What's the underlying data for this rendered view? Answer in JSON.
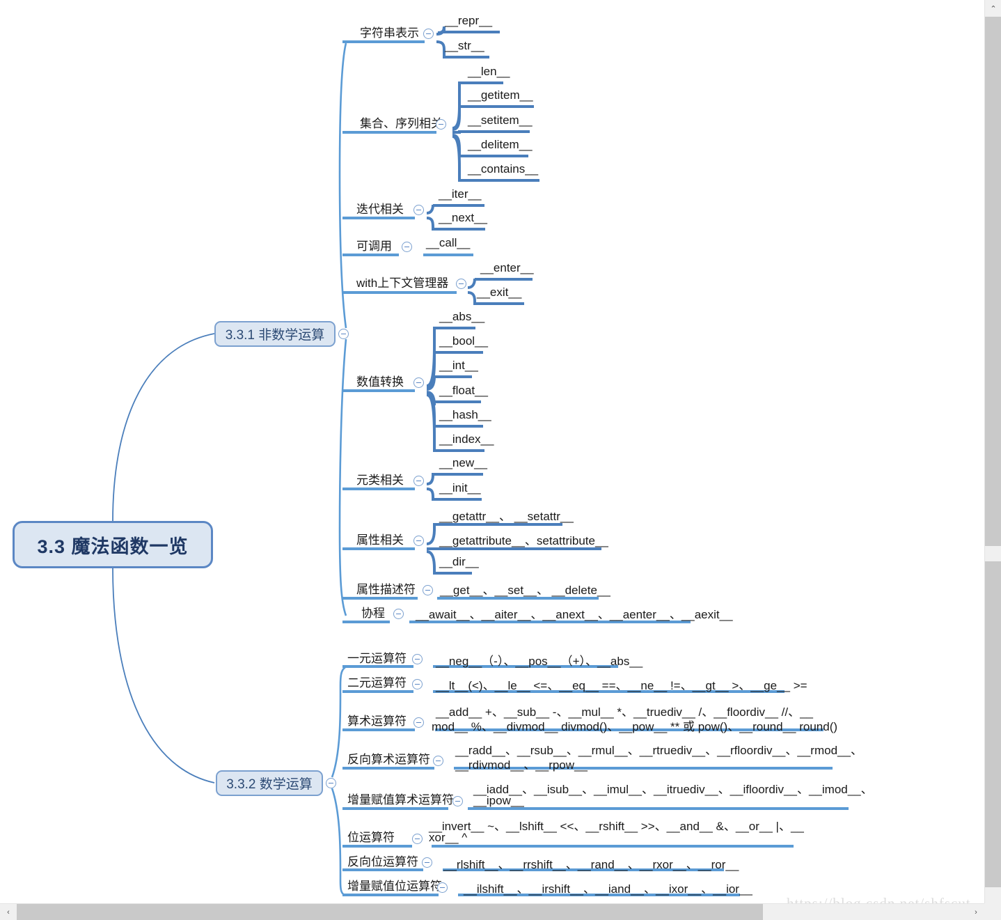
{
  "root": {
    "label": "3.3 魔法函数一览"
  },
  "branches": [
    {
      "id": "b1",
      "label": "3.3.1 非数学运算"
    },
    {
      "id": "b2",
      "label": "3.3.2 数学运算"
    }
  ],
  "nonmath": {
    "categories": [
      {
        "label": "字符串表示",
        "leaves": [
          "__repr__",
          "__str__"
        ]
      },
      {
        "label": "集合、序列相关",
        "leaves": [
          "__len__",
          "__getitem__",
          "__setitem__",
          "__delitem__",
          "__contains__"
        ]
      },
      {
        "label": "迭代相关",
        "leaves": [
          "__iter__",
          "__next__"
        ]
      },
      {
        "label": "可调用",
        "leaves": [
          "__call__"
        ]
      },
      {
        "label": "with上下文管理器",
        "leaves": [
          "__enter__",
          "__exit__"
        ]
      },
      {
        "label": "数值转换",
        "leaves": [
          "__abs__",
          "__bool__",
          "__int__",
          "__float__",
          "__hash__",
          "__index__"
        ]
      },
      {
        "label": "元类相关",
        "leaves": [
          "__new__",
          "__init__"
        ]
      },
      {
        "label": "属性相关",
        "leaves": [
          "__getattr__、 __setattr__",
          "__getattribute__、setattribute__",
          "__dir__"
        ]
      },
      {
        "label": "属性描述符",
        "leaves": [
          "__get__、__set__、 __delete__"
        ]
      },
      {
        "label": "协程",
        "leaves": [
          "__await__、__aiter__、__anext__、__aenter__、__aexit__"
        ]
      }
    ]
  },
  "math": {
    "rows": [
      {
        "label": "一元运算符",
        "label2": "",
        "text": "__neg__（-）、__pos__（+）、__abs__",
        "text2": ""
      },
      {
        "label": "二元运算符",
        "label2": "",
        "text": "__lt__(<)、__le__ <=、__eq__ ==、__ne__ !=、__gt__ >、__ge__ >=",
        "text2": ""
      },
      {
        "label": "算术运算符",
        "label2": "",
        "text": "__add__ +、__sub__ -、__mul__ *、__truediv__ /、__floordiv__ //、__",
        "text2": "mod__ %、__divmod__ divmod()、__pow__ ** 或 pow()、__round__ round()"
      },
      {
        "label": "反向算术运算符",
        "label2": "",
        "text": "__radd__、__rsub__、__rmul__、__rtruediv__、__rfloordiv__、__rmod__、",
        "text2": "__rdivmod__、__rpow__"
      },
      {
        "label": "增量赋值算术运算符",
        "label2": "",
        "text": "__iadd__、__isub__、__imul__、__itruediv__、__ifloordiv__、__imod__、",
        "text2": "__ipow__"
      },
      {
        "label": "位运算符",
        "label2": "",
        "text": "__invert__ ~、__lshift__ <<、__rshift__ >>、__and__ &、__or__ |、__",
        "text2": "xor__ ^"
      },
      {
        "label": "反向位运算符",
        "label2": "",
        "text": "__rlshift__、__rrshift__、__rand__、__rxor__、__ror__",
        "text2": ""
      },
      {
        "label": "增量赋值位运算符",
        "label2": "",
        "text": "__ilshift__、__irshift__、__iand__、__ixor__、__ior__",
        "text2": ""
      }
    ]
  },
  "watermark": {
    "text": "https://blog.csdn.net/shfscut"
  },
  "scrollbars": {
    "up_arrow": "⌃",
    "down_arrow": "⌄",
    "left_arrow": "‹",
    "right_arrow": "›"
  },
  "colors": {
    "line": "#4a7ebb",
    "node_fill": "#dce6f2",
    "node_border": "#5b87c4",
    "root_text": "#1f3864"
  }
}
